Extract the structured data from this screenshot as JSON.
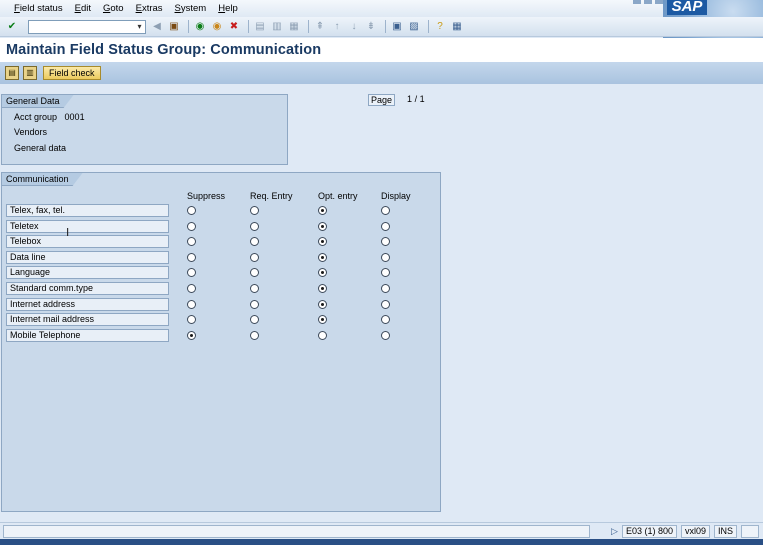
{
  "menu": [
    "Field status",
    "Edit",
    "Goto",
    "Extras",
    "System",
    "Help"
  ],
  "brand": "SAP",
  "title": "Maintain Field Status Group: Communication",
  "app_toolbar": {
    "field_check_label": "Field check"
  },
  "general_data": {
    "tab": "General Data",
    "acct_group_label": "Acct group",
    "acct_group_value": "0001",
    "line2": "Vendors",
    "line3": "General data"
  },
  "paging": {
    "page_label": "Page",
    "current": "1",
    "sep": "/",
    "total": "1"
  },
  "communication": {
    "tab": "Communication",
    "columns": [
      "Suppress",
      "Req. Entry",
      "Opt. entry",
      "Display"
    ],
    "rows": [
      {
        "field": "Telex, fax, tel.",
        "selected": 2
      },
      {
        "field": "Teletex",
        "selected": 2
      },
      {
        "field": "Telebox",
        "selected": 2
      },
      {
        "field": "Data line",
        "selected": 2
      },
      {
        "field": "Language",
        "selected": 2
      },
      {
        "field": "Standard comm.type",
        "selected": 2
      },
      {
        "field": "Internet address",
        "selected": 2
      },
      {
        "field": "Internet mail address",
        "selected": 2
      },
      {
        "field": "Mobile Telephone",
        "selected": 0
      }
    ]
  },
  "status": {
    "system": "E03 (1) 800",
    "server": "vxl09",
    "mode": "INS"
  }
}
